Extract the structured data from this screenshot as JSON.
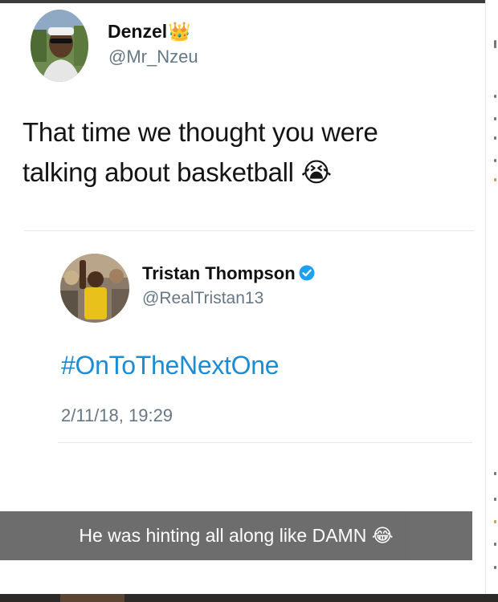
{
  "tweet": {
    "author_name": "Denzel",
    "author_emoji": "👑",
    "author_handle": "@Mr_Nzeu",
    "text_line1": "That time we thought you were",
    "text_line2": "talking about basketball",
    "text_emoji": "😭"
  },
  "quoted_tweet": {
    "author_name": "Tristan Thompson",
    "author_handle": "@RealTristan13",
    "verified": true,
    "hashtag": "#OnToTheNextOne",
    "timestamp": "2/11/18, 19:29"
  },
  "caption": {
    "text": "He was hinting all along like DAMN",
    "emoji": "😂"
  },
  "colors": {
    "hashtag": "#1b8cd6",
    "verified": "#1da1f2",
    "handle": "#657786",
    "caption_bg": "#686868"
  }
}
